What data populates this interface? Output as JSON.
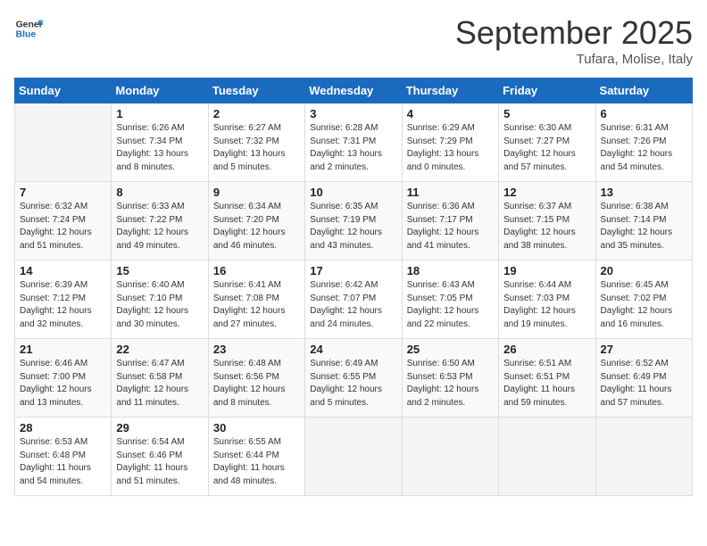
{
  "header": {
    "logo_general": "General",
    "logo_blue": "Blue",
    "month": "September 2025",
    "location": "Tufara, Molise, Italy"
  },
  "weekdays": [
    "Sunday",
    "Monday",
    "Tuesday",
    "Wednesday",
    "Thursday",
    "Friday",
    "Saturday"
  ],
  "weeks": [
    [
      {
        "day": "",
        "info": ""
      },
      {
        "day": "1",
        "info": "Sunrise: 6:26 AM\nSunset: 7:34 PM\nDaylight: 13 hours\nand 8 minutes."
      },
      {
        "day": "2",
        "info": "Sunrise: 6:27 AM\nSunset: 7:32 PM\nDaylight: 13 hours\nand 5 minutes."
      },
      {
        "day": "3",
        "info": "Sunrise: 6:28 AM\nSunset: 7:31 PM\nDaylight: 13 hours\nand 2 minutes."
      },
      {
        "day": "4",
        "info": "Sunrise: 6:29 AM\nSunset: 7:29 PM\nDaylight: 13 hours\nand 0 minutes."
      },
      {
        "day": "5",
        "info": "Sunrise: 6:30 AM\nSunset: 7:27 PM\nDaylight: 12 hours\nand 57 minutes."
      },
      {
        "day": "6",
        "info": "Sunrise: 6:31 AM\nSunset: 7:26 PM\nDaylight: 12 hours\nand 54 minutes."
      }
    ],
    [
      {
        "day": "7",
        "info": "Sunrise: 6:32 AM\nSunset: 7:24 PM\nDaylight: 12 hours\nand 51 minutes."
      },
      {
        "day": "8",
        "info": "Sunrise: 6:33 AM\nSunset: 7:22 PM\nDaylight: 12 hours\nand 49 minutes."
      },
      {
        "day": "9",
        "info": "Sunrise: 6:34 AM\nSunset: 7:20 PM\nDaylight: 12 hours\nand 46 minutes."
      },
      {
        "day": "10",
        "info": "Sunrise: 6:35 AM\nSunset: 7:19 PM\nDaylight: 12 hours\nand 43 minutes."
      },
      {
        "day": "11",
        "info": "Sunrise: 6:36 AM\nSunset: 7:17 PM\nDaylight: 12 hours\nand 41 minutes."
      },
      {
        "day": "12",
        "info": "Sunrise: 6:37 AM\nSunset: 7:15 PM\nDaylight: 12 hours\nand 38 minutes."
      },
      {
        "day": "13",
        "info": "Sunrise: 6:38 AM\nSunset: 7:14 PM\nDaylight: 12 hours\nand 35 minutes."
      }
    ],
    [
      {
        "day": "14",
        "info": "Sunrise: 6:39 AM\nSunset: 7:12 PM\nDaylight: 12 hours\nand 32 minutes."
      },
      {
        "day": "15",
        "info": "Sunrise: 6:40 AM\nSunset: 7:10 PM\nDaylight: 12 hours\nand 30 minutes."
      },
      {
        "day": "16",
        "info": "Sunrise: 6:41 AM\nSunset: 7:08 PM\nDaylight: 12 hours\nand 27 minutes."
      },
      {
        "day": "17",
        "info": "Sunrise: 6:42 AM\nSunset: 7:07 PM\nDaylight: 12 hours\nand 24 minutes."
      },
      {
        "day": "18",
        "info": "Sunrise: 6:43 AM\nSunset: 7:05 PM\nDaylight: 12 hours\nand 22 minutes."
      },
      {
        "day": "19",
        "info": "Sunrise: 6:44 AM\nSunset: 7:03 PM\nDaylight: 12 hours\nand 19 minutes."
      },
      {
        "day": "20",
        "info": "Sunrise: 6:45 AM\nSunset: 7:02 PM\nDaylight: 12 hours\nand 16 minutes."
      }
    ],
    [
      {
        "day": "21",
        "info": "Sunrise: 6:46 AM\nSunset: 7:00 PM\nDaylight: 12 hours\nand 13 minutes."
      },
      {
        "day": "22",
        "info": "Sunrise: 6:47 AM\nSunset: 6:58 PM\nDaylight: 12 hours\nand 11 minutes."
      },
      {
        "day": "23",
        "info": "Sunrise: 6:48 AM\nSunset: 6:56 PM\nDaylight: 12 hours\nand 8 minutes."
      },
      {
        "day": "24",
        "info": "Sunrise: 6:49 AM\nSunset: 6:55 PM\nDaylight: 12 hours\nand 5 minutes."
      },
      {
        "day": "25",
        "info": "Sunrise: 6:50 AM\nSunset: 6:53 PM\nDaylight: 12 hours\nand 2 minutes."
      },
      {
        "day": "26",
        "info": "Sunrise: 6:51 AM\nSunset: 6:51 PM\nDaylight: 11 hours\nand 59 minutes."
      },
      {
        "day": "27",
        "info": "Sunrise: 6:52 AM\nSunset: 6:49 PM\nDaylight: 11 hours\nand 57 minutes."
      }
    ],
    [
      {
        "day": "28",
        "info": "Sunrise: 6:53 AM\nSunset: 6:48 PM\nDaylight: 11 hours\nand 54 minutes."
      },
      {
        "day": "29",
        "info": "Sunrise: 6:54 AM\nSunset: 6:46 PM\nDaylight: 11 hours\nand 51 minutes."
      },
      {
        "day": "30",
        "info": "Sunrise: 6:55 AM\nSunset: 6:44 PM\nDaylight: 11 hours\nand 48 minutes."
      },
      {
        "day": "",
        "info": ""
      },
      {
        "day": "",
        "info": ""
      },
      {
        "day": "",
        "info": ""
      },
      {
        "day": "",
        "info": ""
      }
    ]
  ]
}
